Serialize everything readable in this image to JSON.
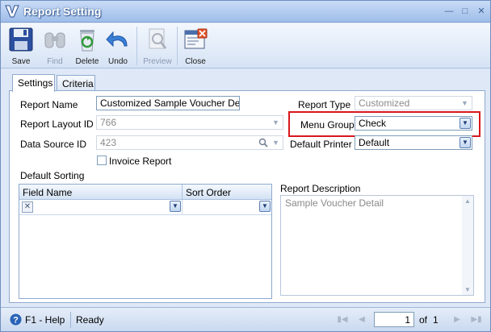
{
  "window": {
    "title": "Report Setting"
  },
  "toolbar": {
    "save": "Save",
    "find": "Find",
    "delete": "Delete",
    "undo": "Undo",
    "preview": "Preview",
    "close": "Close"
  },
  "tabs": {
    "settings": "Settings",
    "criteria": "Criteria"
  },
  "form": {
    "report_name_label": "Report Name",
    "report_name_value": "Customized Sample Voucher Detail",
    "report_layout_label": "Report Layout ID",
    "report_layout_value": "766",
    "data_source_label": "Data Source ID",
    "data_source_value": "423",
    "invoice_report_label": "Invoice Report",
    "report_type_label": "Report Type",
    "report_type_value": "Customized",
    "menu_group_label": "Menu Group",
    "menu_group_value": "Check",
    "default_printer_label": "Default Printer",
    "default_printer_value": "Default"
  },
  "sorting": {
    "title": "Default Sorting",
    "columns": [
      "Field Name",
      "Sort Order"
    ]
  },
  "description": {
    "label": "Report Description",
    "value": "Sample Voucher Detail"
  },
  "status": {
    "help": "F1 - Help",
    "state": "Ready",
    "page": "1",
    "of_label": "of",
    "total_pages": "1"
  },
  "colors": {
    "highlight": "#d9161c",
    "accent": "#3b5f93"
  }
}
